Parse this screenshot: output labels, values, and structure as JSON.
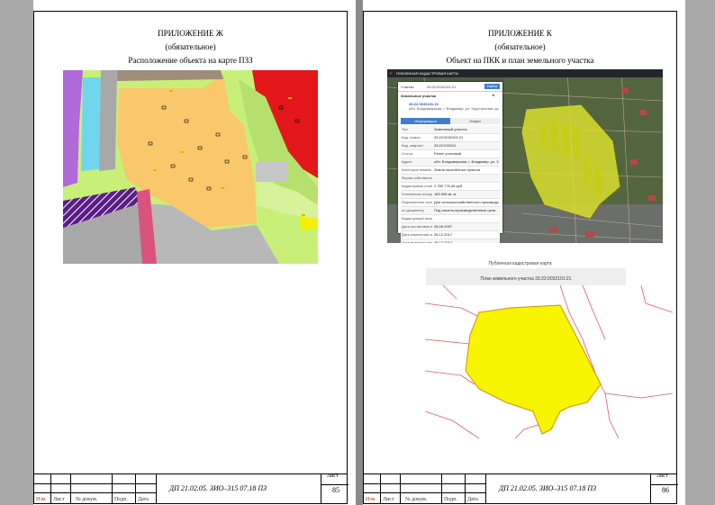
{
  "left_page": {
    "title": "ПРИЛОЖЕНИЕ Ж",
    "subtitle": "(обязательное)",
    "caption": "Расположение объекта на карте ПЗЗ",
    "stamp": {
      "col_izm": "Изм",
      "col_list": "Лист",
      "col_doc": "№ докум.",
      "col_sign": "Подп.",
      "col_date": "Дата",
      "doc_code": "ДП 21.02.05. ЗИО–315 07.18 ПЗ",
      "sheet_label": "Лист",
      "sheet_number": "85"
    }
  },
  "right_page": {
    "title": "ПРИЛОЖЕНИЕ К",
    "subtitle": "(обязательное)",
    "caption": "Объект на ПКК и план земельного участка",
    "pkk": {
      "app_title": "ПУБЛИЧНАЯ КАДАСТРОВАЯ КАРТА",
      "search_type": "Участки",
      "search_value": "33:22:0032101:21",
      "search_button": "Найти",
      "panel_title": "Земельные участки",
      "item_number": "33:22:0032101:21",
      "item_address": "обл. Владимирская, г. Владимир, ул. Хрустальная, дом 25",
      "tab_info": "Информация",
      "tab_services": "Услуги",
      "rows": [
        {
          "k": "Тип",
          "v": "Земельный участок"
        },
        {
          "k": "Кад. номер",
          "v": "33:22:0032101:21"
        },
        {
          "k": "Кад. квартал",
          "v": "33:22:032101"
        },
        {
          "k": "Статус",
          "v": "Ранее учтенный"
        },
        {
          "k": "Адрес",
          "v": "обл. Владимирская, г. Владимир, ул. Хрустальная, дом 25"
        },
        {
          "k": "Категория земель",
          "v": "Земли населённых пунктов"
        },
        {
          "k": "Форма собственности",
          "v": ""
        },
        {
          "k": "Кадастровая стоимость",
          "v": "2 789 776,06 руб."
        },
        {
          "k": "Уточненная площадь",
          "v": "183 998 кв. м"
        },
        {
          "k": "Разрешенное использование",
          "v": "Для сельскохозяйственного производства"
        },
        {
          "k": "по документу",
          "v": "Под опытно-производственные цели"
        },
        {
          "k": "Кадастровый инженер",
          "v": ""
        },
        {
          "k": "Дата постановки на учет",
          "v": "28.06.2007"
        },
        {
          "k": "Дата изменения сведений в ГКН",
          "v": "28.12.2017"
        },
        {
          "k": "Дата выгрузки сведений из ГКН",
          "v": "28.12.2017"
        }
      ]
    },
    "plan_header": "Публичная кадастровая карта",
    "plan_title": "План земельного участка 33:22:0032101:21",
    "stamp": {
      "col_izm": "Изм",
      "col_list": "Лист",
      "col_doc": "№ докум.",
      "col_sign": "Подп.",
      "col_date": "Дата",
      "doc_code": "ДП 21.02.05. ЗИО–315 07.18 ПЗ",
      "sheet_label": "Лист",
      "sheet_number": "86"
    }
  },
  "colors": {
    "pzz_orange": "#f9c86a",
    "pzz_green": "#c8f079",
    "pzz_red": "#e3161a",
    "pzz_purple": "#5b1e86",
    "pzz_violet": "#b06ad9",
    "pzz_grey": "#a8a8a8",
    "pzz_cyan": "#6fd6ee",
    "parcel_yellow": "#f7f500",
    "parcel_border": "#d98c00"
  }
}
